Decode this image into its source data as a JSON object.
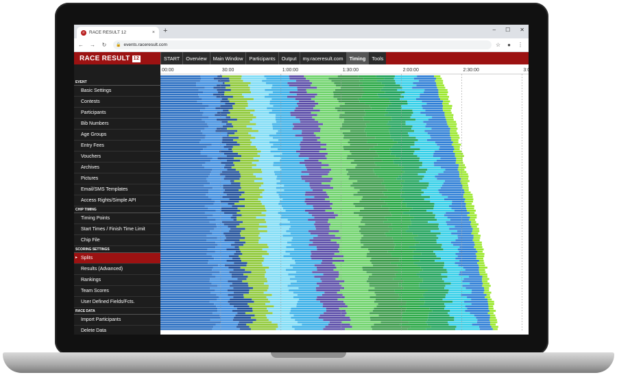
{
  "browser": {
    "tab_title": "RACE RESULT 12",
    "tab_close": "×",
    "new_tab": "+",
    "url": "events.raceresult.com",
    "favicon_text": "rr",
    "controls": {
      "minimize": "–",
      "maximize": "☐",
      "close": "✕"
    },
    "nav": {
      "back": "←",
      "forward": "→",
      "reload": "↻"
    },
    "icons": {
      "star": "☆",
      "account": "●",
      "menu": "⋮",
      "lock": "🔒"
    }
  },
  "app": {
    "logo_text": "RACE RESULT",
    "logo_num": "12",
    "menu": [
      "START",
      "Overview",
      "Main Window",
      "Participants",
      "Output",
      "my.raceresult.com",
      "Timing",
      "Tools"
    ],
    "active_menu": "Timing",
    "brand_color": "#9c1212"
  },
  "sidebar": {
    "sections": [
      {
        "header": "EVENT",
        "items": [
          "Basic Settings",
          "Contests",
          "Participants",
          "Bib Numbers",
          "Age Groups",
          "Entry Fees",
          "Vouchers",
          "Archives",
          "Pictures",
          "Email/SMS Templates",
          "Access Rights/Simple API"
        ]
      },
      {
        "header": "CHIP TIMING",
        "items": [
          "Timing Points",
          "Start Times / Finish Time Limit",
          "Chip File"
        ]
      },
      {
        "header": "SCORING SETTINGS",
        "items": [
          "Splits",
          "Results (Advanced)",
          "Rankings",
          "Team Scores",
          "User Defined Fields/Fcts."
        ]
      },
      {
        "header": "RACE DATA",
        "items": [
          "Import Participants",
          "Delete Data"
        ]
      }
    ],
    "active_item": "Splits"
  },
  "chart_data": {
    "type": "bar",
    "orientation": "horizontal-stacked",
    "x_axis_ticks": [
      "00:00",
      "30:00",
      "1:00:00",
      "1:30:00",
      "2:00:00",
      "2:30:00",
      "3:0"
    ],
    "x_tick_minutes": [
      0,
      30,
      60,
      90,
      120,
      150,
      180
    ],
    "xlim_minutes": [
      0,
      182
    ],
    "segment_colors": [
      "#2b6fc2",
      "#3f8ee0",
      "#1f4f9a",
      "#8fc93a",
      "#7fdcf5",
      "#3bb0e8",
      "#5a4da8",
      "#6ed36b",
      "#3b9a4a",
      "#29a845",
      "#1fa25a",
      "#35cfe8",
      "#2f7fd6",
      "#9be82e"
    ],
    "segment_end_minutes_first_row": [
      20,
      28,
      33,
      42,
      52,
      64,
      74,
      86,
      98,
      108,
      118,
      126,
      136,
      140
    ],
    "segment_end_minutes_last_row": [
      28,
      37,
      45,
      56,
      68,
      82,
      93,
      108,
      122,
      134,
      146,
      156,
      165,
      168
    ],
    "grid": true
  }
}
